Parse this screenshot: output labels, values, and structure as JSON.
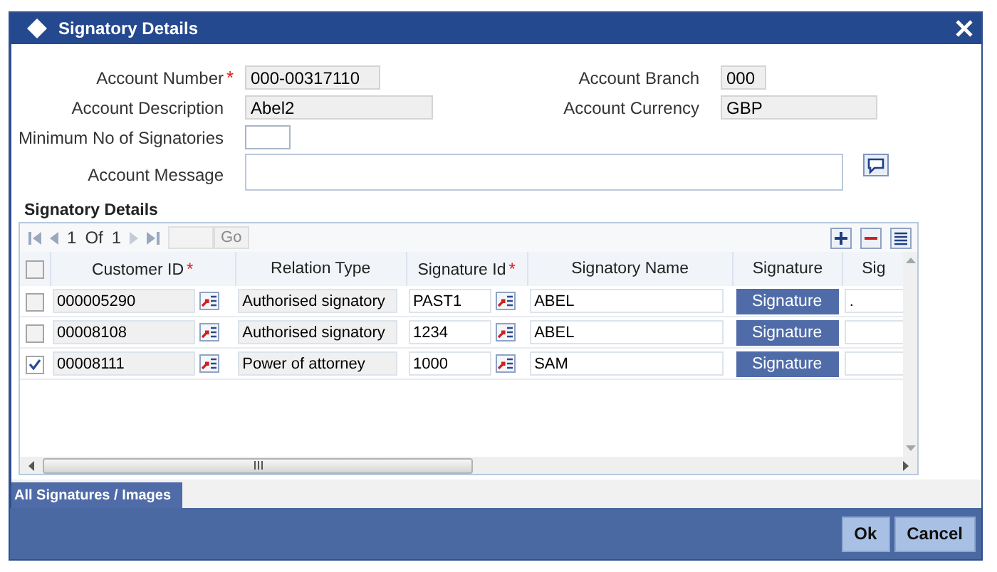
{
  "window": {
    "title": "Signatory Details"
  },
  "left_fields": [
    {
      "label": "Account Number",
      "mark": "*",
      "value": "000-00317110"
    },
    {
      "label": "Account Description",
      "value": "Abel2"
    },
    {
      "label": "Minimum No of Signatories",
      "editable": true
    }
  ],
  "right_fields": [
    {
      "label": "Account Branch",
      "value": "000"
    },
    {
      "label": "Account Currency",
      "value": "GBP"
    }
  ],
  "message": {
    "label": "Account Message"
  },
  "section_title": "Signatory Details",
  "pager": {
    "page": "1",
    "of": "Of",
    "total": "1",
    "go": "Go"
  },
  "table": {
    "all_selected": false,
    "columns": [
      {
        "label": "Customer ID",
        "mark": "*"
      },
      {
        "label": "Relation Type"
      },
      {
        "label": "Signature Id",
        "mark": "*"
      },
      {
        "label": "Signatory Name"
      },
      {
        "label": "Signature"
      },
      {
        "label": "Sig"
      }
    ],
    "rows": [
      {
        "selected": false,
        "customer_id": "000005290",
        "relation_type": "Authorised signatory",
        "signature_id": "PAST1",
        "signatory_name": "ABEL",
        "signature": "Signature",
        "column_6": "."
      },
      {
        "selected": false,
        "customer_id": "00008108",
        "relation_type": "Authorised signatory",
        "signature_id": "1234",
        "signatory_name": "ABEL",
        "signature": "Signature"
      },
      {
        "selected": true,
        "customer_id": "00008111",
        "relation_type": "Power of attorney",
        "signature_id": "1000",
        "signatory_name": "SAM",
        "signature": "Signature"
      }
    ]
  },
  "tabs": [
    {
      "label": "All Signatures / Images",
      "selected": true
    }
  ],
  "buttons": [
    "Ok",
    "Cancel"
  ]
}
